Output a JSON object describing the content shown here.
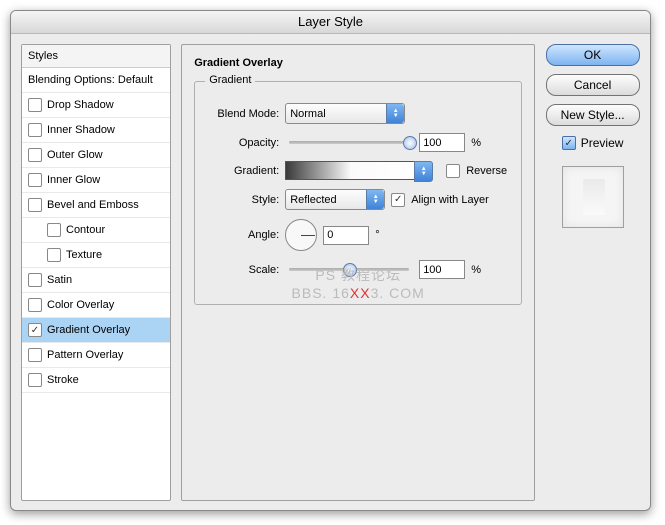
{
  "title": "Layer Style",
  "sidebar": {
    "header": "Styles",
    "blending": "Blending Options: Default",
    "items": [
      {
        "label": "Drop Shadow",
        "on": false,
        "sel": false
      },
      {
        "label": "Inner Shadow",
        "on": false,
        "sel": false
      },
      {
        "label": "Outer Glow",
        "on": false,
        "sel": false
      },
      {
        "label": "Inner Glow",
        "on": false,
        "sel": false
      },
      {
        "label": "Bevel and Emboss",
        "on": false,
        "sel": false
      },
      {
        "label": "Contour",
        "on": false,
        "sel": false,
        "sub": true
      },
      {
        "label": "Texture",
        "on": false,
        "sel": false,
        "sub": true
      },
      {
        "label": "Satin",
        "on": false,
        "sel": false
      },
      {
        "label": "Color Overlay",
        "on": false,
        "sel": false
      },
      {
        "label": "Gradient Overlay",
        "on": true,
        "sel": true
      },
      {
        "label": "Pattern Overlay",
        "on": false,
        "sel": false
      },
      {
        "label": "Stroke",
        "on": false,
        "sel": false
      }
    ]
  },
  "panel": {
    "title": "Gradient Overlay",
    "group": "Gradient",
    "blend_mode_label": "Blend Mode:",
    "blend_mode_value": "Normal",
    "opacity_label": "Opacity:",
    "opacity_value": "100",
    "opacity_unit": "%",
    "gradient_label": "Gradient:",
    "reverse_label": "Reverse",
    "reverse_on": false,
    "style_label": "Style:",
    "style_value": "Reflected",
    "align_label": "Align with Layer",
    "align_on": true,
    "angle_label": "Angle:",
    "angle_value": "0",
    "angle_unit": "°",
    "scale_label": "Scale:",
    "scale_value": "100",
    "scale_unit": "%"
  },
  "buttons": {
    "ok": "OK",
    "cancel": "Cancel",
    "new_style": "New Style...",
    "preview": "Preview"
  },
  "watermark": {
    "l1": "PS 教程论坛",
    "l2a": "BBS. 16",
    "x": "XX",
    "l2b": "3. COM"
  }
}
